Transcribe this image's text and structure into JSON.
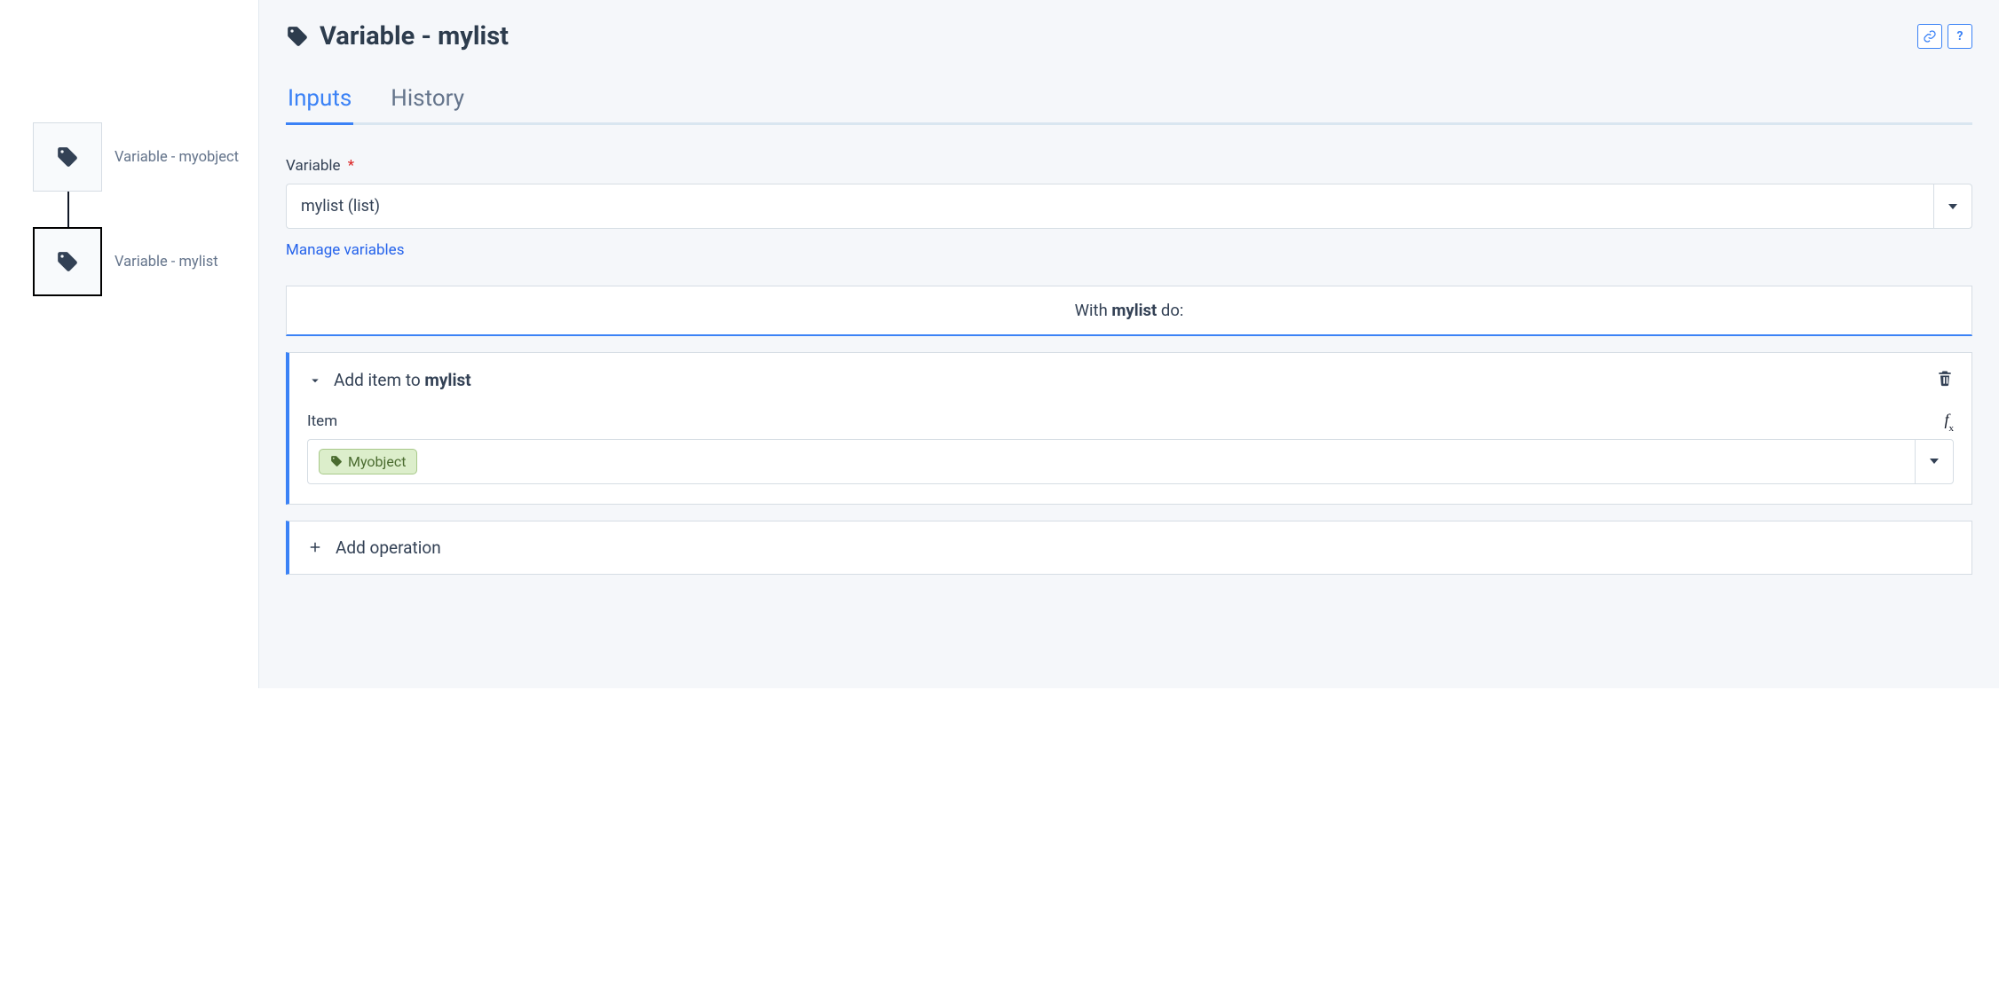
{
  "canvas": {
    "nodes": [
      {
        "label": "Variable - myobject"
      },
      {
        "label": "Variable - mylist"
      }
    ]
  },
  "header": {
    "title": "Variable - mylist"
  },
  "tabs": [
    {
      "label": "Inputs"
    },
    {
      "label": "History"
    }
  ],
  "variableField": {
    "label": "Variable",
    "required": "*",
    "selected": "mylist (list)",
    "manageLink": "Manage variables"
  },
  "withBlock": {
    "prefix": "With ",
    "name": "mylist",
    "suffix": " do:"
  },
  "operation": {
    "titlePrefix": "Add item to ",
    "titleBold": "mylist",
    "itemLabel": "Item",
    "pillText": "Myobject"
  },
  "addOperation": {
    "label": "Add operation"
  }
}
